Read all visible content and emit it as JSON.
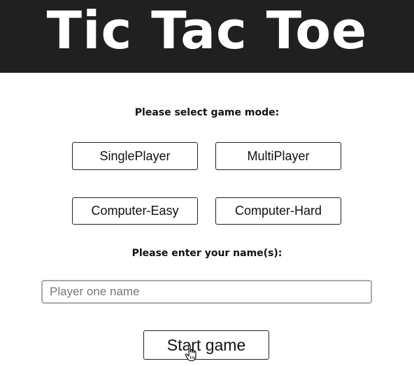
{
  "header": {
    "title": "Tic Tac Toe"
  },
  "game_mode": {
    "label": "Please select game mode:",
    "options": [
      {
        "label": "SinglePlayer"
      },
      {
        "label": "MultiPlayer"
      },
      {
        "label": "Computer-Easy"
      },
      {
        "label": "Computer-Hard"
      }
    ]
  },
  "names": {
    "label": "Please enter your name(s):",
    "player_one": {
      "value": "",
      "placeholder": "Player one name"
    }
  },
  "start_button": {
    "label": "Start game"
  },
  "cursor": {
    "icon": "hand-pointer-icon"
  },
  "colors": {
    "header_bg": "#202020",
    "header_text": "#ffffff",
    "button_border": "#222222",
    "input_border": "#aaaaaa"
  }
}
